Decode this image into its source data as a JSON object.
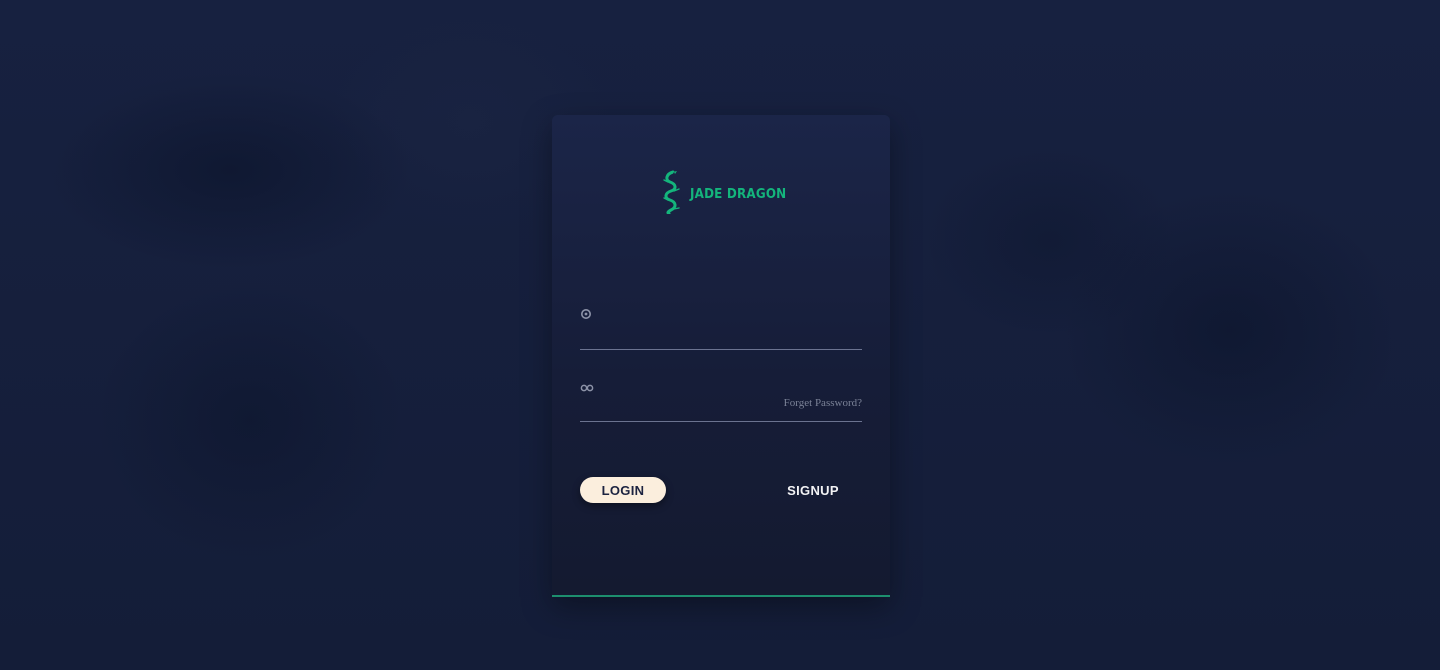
{
  "brand": {
    "name": "JADE DRAGON",
    "logo_icon": "dragon-icon",
    "accent_color": "#14b57c"
  },
  "form": {
    "username": {
      "icon": "user-icon",
      "value": "",
      "placeholder": ""
    },
    "password": {
      "icon": "key-icon",
      "value": "",
      "placeholder": "",
      "forgot_label": "Forget Password?"
    }
  },
  "actions": {
    "login_label": "LOGIN",
    "signup_label": "SIGNUP"
  },
  "colors": {
    "background": "#151f3b",
    "card": "#1b2548",
    "login_button": "#fbeedd",
    "card_bottom_border": "#1d8f6e"
  }
}
